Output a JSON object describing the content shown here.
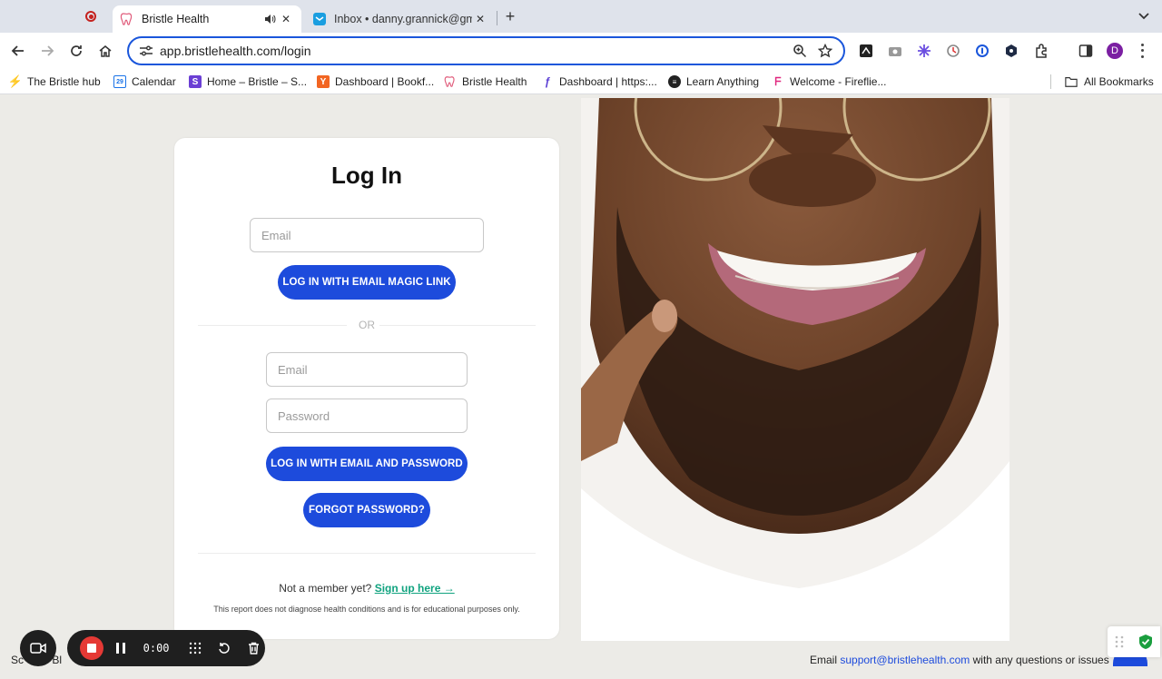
{
  "browser": {
    "tabs": [
      {
        "title": "Bristle Health",
        "active": true
      },
      {
        "title": "Inbox • danny.grannick@gmail.com",
        "active": false
      }
    ],
    "url": "app.bristlehealth.com/login",
    "profile_initial": "D",
    "bookmarks": [
      {
        "label": "The Bristle hub",
        "icon": "bolt-icon"
      },
      {
        "label": "Calendar",
        "icon": "calendar-icon"
      },
      {
        "label": "Home – Bristle – S...",
        "icon": "s-icon"
      },
      {
        "label": "Dashboard | Bookf...",
        "icon": "y-icon"
      },
      {
        "label": "Bristle Health",
        "icon": "tooth-icon"
      },
      {
        "label": "Dashboard | https:...",
        "icon": "f-icon"
      },
      {
        "label": "Learn Anything",
        "icon": "hat-icon"
      },
      {
        "label": "Welcome - Fireflie...",
        "icon": "fireflies-icon"
      }
    ],
    "all_bookmarks": "All Bookmarks",
    "calendar_day": "29"
  },
  "login": {
    "title": "Log In",
    "magic_email_placeholder": "Email",
    "magic_button": "LOG IN WITH EMAIL MAGIC LINK",
    "or": "OR",
    "email_placeholder": "Email",
    "password_placeholder": "Password",
    "password_button": "LOG IN WITH EMAIL AND PASSWORD",
    "forgot_button": "FORGOT PASSWORD?",
    "member_prompt": "Not a member yet?",
    "signup_link": "Sign up here →",
    "disclaimer": "This report does not diagnose health conditions and is for educational purposes only."
  },
  "footer": {
    "left_text": "Sc",
    "left_text2": "Bl",
    "email_prefix": "Email",
    "support_email": "support@bristlehealth.com",
    "email_suffix": "with any questions or issues"
  },
  "recorder": {
    "time": "0:00"
  },
  "colors": {
    "brand_blue": "#1d4bdc",
    "signup_green": "#10a37f",
    "page_bg": "#ecebe7"
  }
}
